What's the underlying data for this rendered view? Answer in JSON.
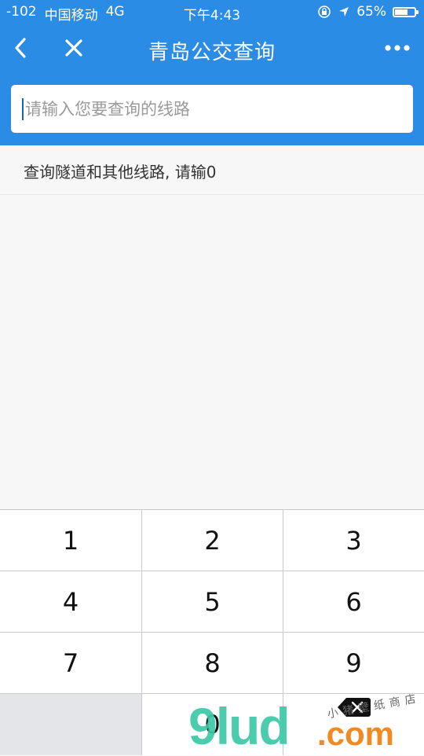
{
  "status_bar": {
    "signal": "-102",
    "carrier": "中国移动",
    "network": "4G",
    "time": "下午4:43",
    "battery_percent": "65%",
    "battery_level": 0.65
  },
  "nav": {
    "title": "青岛公交查询"
  },
  "search": {
    "placeholder": "请输入您要查询的线路",
    "value": ""
  },
  "hint": {
    "text": "查询隧道和其他线路, 请输0"
  },
  "keypad": {
    "keys": [
      "1",
      "2",
      "3",
      "4",
      "5",
      "6",
      "7",
      "8",
      "9",
      "",
      "0",
      "delete"
    ]
  },
  "watermark": {
    "main": "9lud",
    "domain": ".com",
    "sub": "小猪壁纸商店"
  },
  "colors": {
    "brand_blue": "#2b8ce6",
    "key_border": "#c9c9c9",
    "blank_key": "#e4e5e9"
  }
}
